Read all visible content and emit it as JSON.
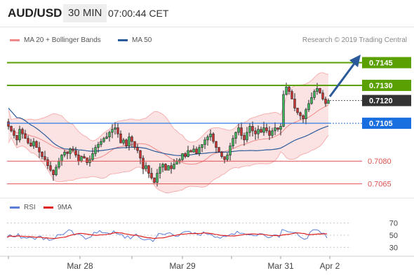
{
  "header": {
    "pair": "AUD/USD",
    "timeframe": "30 MIN",
    "time": "07:00:44 CET"
  },
  "legend": {
    "ma20": {
      "label": "MA 20 + Bollinger Bands",
      "color": "#f08a8a"
    },
    "ma50": {
      "label": "MA 50",
      "color": "#2a5a9a"
    }
  },
  "credit": "Research © 2019 Trading Central",
  "rsi_legend": {
    "rsi": {
      "label": "RSI",
      "color": "#5b7fd6"
    },
    "ma9": {
      "label": "9MA",
      "color": "#e02020"
    }
  },
  "chart_data": [
    {
      "type": "candlestick",
      "y_range": [
        0.7057,
        0.7154
      ],
      "x_labels": [
        "Mar 28",
        "Mar 29",
        "Mar 31",
        "Apr 2"
      ],
      "levels": [
        {
          "value": 0.7145,
          "label": "0.7145",
          "kind": "resistance",
          "color": "#5aa000"
        },
        {
          "value": 0.713,
          "label": "0.7130",
          "kind": "resistance",
          "color": "#5aa000"
        },
        {
          "value": 0.712,
          "label": "0.7120",
          "kind": "last",
          "color": "#333333"
        },
        {
          "value": 0.7105,
          "label": "0.7105",
          "kind": "pivot",
          "color": "#1a6fe0"
        },
        {
          "value": 0.708,
          "label": "0.7080",
          "kind": "support",
          "color": "#e05050"
        },
        {
          "value": 0.7065,
          "label": "0.7065",
          "kind": "support",
          "color": "#e05050"
        }
      ],
      "close_path": [
        0.7103,
        0.71,
        0.7097,
        0.7094,
        0.7101,
        0.7098,
        0.7095,
        0.7092,
        0.709,
        0.7093,
        0.7089,
        0.7086,
        0.7083,
        0.7081,
        0.7077,
        0.7074,
        0.7071,
        0.7076,
        0.708,
        0.7084,
        0.7086,
        0.7085,
        0.7088,
        0.7087,
        0.7084,
        0.708,
        0.7083,
        0.7082,
        0.7079,
        0.7081,
        0.7085,
        0.7089,
        0.7091,
        0.7093,
        0.7095,
        0.7096,
        0.7099,
        0.7101,
        0.7102,
        0.7098,
        0.7092,
        0.7094,
        0.709,
        0.7096,
        0.7093,
        0.7089,
        0.7087,
        0.7082,
        0.7075,
        0.7077,
        0.7072,
        0.7069,
        0.7066,
        0.7072,
        0.7076,
        0.7078,
        0.7074,
        0.7077,
        0.7075,
        0.7078,
        0.708,
        0.7081,
        0.7085,
        0.7083,
        0.7087,
        0.7086,
        0.7088,
        0.7085,
        0.7089,
        0.7091,
        0.7094,
        0.7096,
        0.7098,
        0.7093,
        0.7089,
        0.7086,
        0.7083,
        0.7081,
        0.7084,
        0.709,
        0.7095,
        0.7099,
        0.7102,
        0.7097,
        0.7094,
        0.7099,
        0.7103,
        0.71,
        0.7098,
        0.7101,
        0.7099,
        0.7102,
        0.71,
        0.7097,
        0.71,
        0.7102,
        0.7101,
        0.7103,
        0.7124,
        0.7129,
        0.7126,
        0.7121,
        0.7115,
        0.7112,
        0.711,
        0.7108,
        0.7114,
        0.7118,
        0.7122,
        0.7126,
        0.7128,
        0.7125,
        0.7121,
        0.7118,
        0.712
      ]
    },
    {
      "type": "line",
      "title": "RSI",
      "ticks": [
        30,
        50,
        70
      ],
      "y_range": [
        20,
        80
      ]
    }
  ]
}
